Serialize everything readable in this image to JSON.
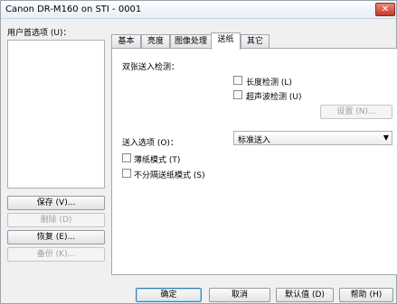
{
  "window": {
    "title": "Canon DR-M160 on STI - 0001",
    "close_label": "✕"
  },
  "preferences": {
    "label": "用户首选项 (U)：",
    "buttons": {
      "save": "保存 (V)...",
      "delete": "删除 (D)",
      "restore": "恢复 (E)...",
      "backup": "备份 (K)..."
    }
  },
  "tabs": [
    "基本",
    "亮度",
    "图像处理",
    "送纸",
    "其它"
  ],
  "active_tab": "送纸",
  "feeding": {
    "double_feed_label": "双张送入检测：",
    "length_detection": "长度检测 (L)",
    "ultrasonic_detection": "超声波检测 (U)",
    "settings_button": "设置 (N)...",
    "feed_option_label": "送入选项 (O)：",
    "feed_option_value": "标准送入",
    "thin_paper_mode": "薄纸模式 (T)",
    "no_separation_mode": "不分隔送纸模式 (S)"
  },
  "footer": {
    "ok": "确定",
    "cancel": "取消",
    "defaults": "默认值 (D)",
    "help": "帮助 (H)"
  }
}
